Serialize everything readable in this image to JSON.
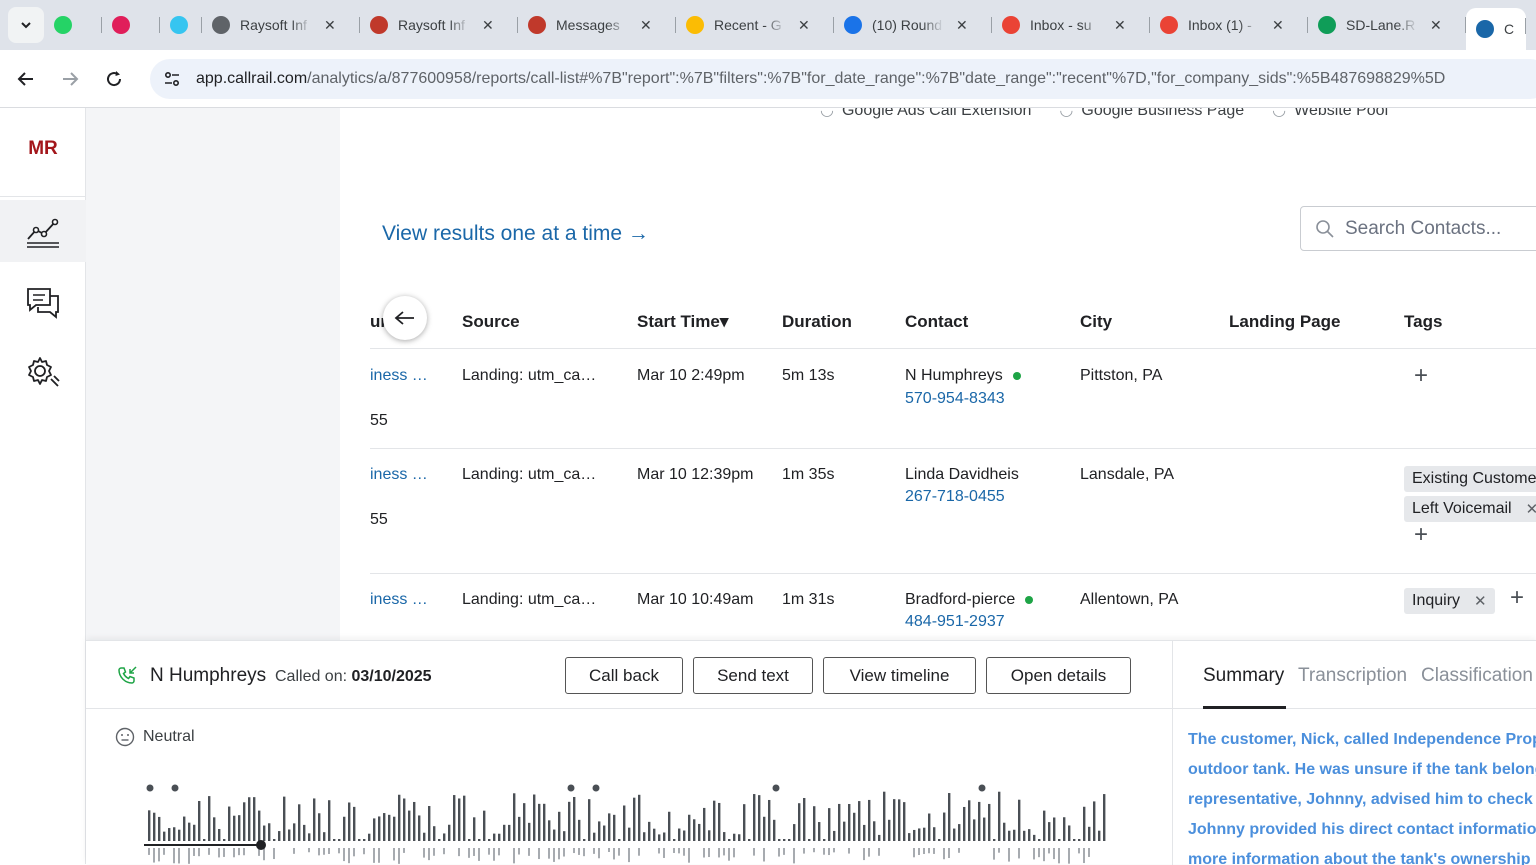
{
  "browser": {
    "tabs": [
      {
        "title": "",
        "icon": "whatsapp-icon",
        "color": "#25d366"
      },
      {
        "title": "",
        "icon": "slack-icon",
        "color": "#e01e5a"
      },
      {
        "title": "",
        "icon": "slack-icon",
        "color": "#36c5f0"
      },
      {
        "title": "Raysoft Inf",
        "icon": "globe-icon",
        "color": "#5f6368"
      },
      {
        "title": "Raysoft Inf",
        "icon": "raysoft-icon",
        "color": "#c0392b"
      },
      {
        "title": "Messages",
        "icon": "messages-icon",
        "color": "#c0392b"
      },
      {
        "title": "Recent - G",
        "icon": "google-drive-icon",
        "color": "#fbbc04"
      },
      {
        "title": "(10) Round",
        "icon": "round-icon",
        "color": "#1a73e8"
      },
      {
        "title": "Inbox - su",
        "icon": "gmail-icon",
        "color": "#ea4335"
      },
      {
        "title": "Inbox (1) -",
        "icon": "gmail-icon",
        "color": "#ea4335"
      },
      {
        "title": "SD-Lane.R",
        "icon": "sheets-icon",
        "color": "#0f9d58"
      },
      {
        "title": "C",
        "icon": "callrail-icon",
        "color": "#1a67a8"
      }
    ],
    "close_glyph": "✕",
    "url_host": "app.callrail.com",
    "url_rest": "/analytics/a/877600958/reports/call-list#%7B\"report\":%7B\"filters\":%7B\"for_date_range\":%7B\"date_range\":\"recent\"%7D,\"for_company_sids\":%5B487698829%5D"
  },
  "sidebar": {
    "logo": "MR",
    "items": [
      {
        "name": "analytics",
        "icon": "analytics-icon",
        "active": true
      },
      {
        "name": "conversations",
        "icon": "chat-icon",
        "active": false
      },
      {
        "name": "settings",
        "icon": "settings-icon",
        "active": false
      }
    ]
  },
  "filters": {
    "pools": [
      "Google Ads Call Extension",
      "Google Business Page",
      "Website Pool"
    ]
  },
  "view_link": "View results one at a time →",
  "search": {
    "placeholder": "Search Contacts..."
  },
  "table": {
    "columns": {
      "tracking": "un",
      "source": "Source",
      "start_time": "Start Time▾",
      "duration": "Duration",
      "contact": "Contact",
      "city": "City",
      "landing_page": "Landing Page",
      "tags": "Tags"
    },
    "rows": [
      {
        "tracking": "iness …",
        "tracking_sub": "55",
        "source": "Landing: utm_ca…",
        "start_time": "Mar 10 2:49pm",
        "duration": "5m 13s",
        "contact_name": "N Humphreys",
        "contact_phone": "570-954-8343",
        "city": "Pittston, PA",
        "tags": []
      },
      {
        "tracking": "iness …",
        "tracking_sub": "55",
        "source": "Landing: utm_ca…",
        "start_time": "Mar 10 12:39pm",
        "duration": "1m 35s",
        "contact_name": "Linda Davidheis",
        "contact_phone": "267-718-0455",
        "city": "Lansdale, PA",
        "tags": [
          "Existing Custome",
          "Left Voicemail"
        ]
      },
      {
        "tracking": "iness …",
        "tracking_sub": "",
        "source": "Landing: utm_ca…",
        "start_time": "Mar 10 10:49am",
        "duration": "1m 31s",
        "contact_name": "Bradford-pierce",
        "contact_phone": "484-951-2937",
        "city": "Allentown, PA",
        "tags": [
          "Inquiry"
        ]
      }
    ]
  },
  "call_panel": {
    "caller_name": "N Humphreys",
    "called_on_label": "Called on:",
    "called_on_date": "03/10/2025",
    "buttons": {
      "call_back": "Call back",
      "send_text": "Send text",
      "view_timeline": "View timeline",
      "open_details": "Open details"
    },
    "sentiment": "Neutral",
    "tabs": {
      "summary": "Summary",
      "transcription": "Transcription",
      "classification": "Classification"
    },
    "summary_lines": [
      "The customer, Nick, called Independence Prop",
      "outdoor tank. He was unsure if the tank belong",
      "representative, Johnny, advised him to check f",
      "Johnny provided his direct contact informatio",
      "more information about the tank's ownership"
    ]
  },
  "colors": {
    "accent": "#1a67a8",
    "brand": "#a3161b",
    "online": "#1ea446",
    "summary_text": "#4b8fdc"
  }
}
